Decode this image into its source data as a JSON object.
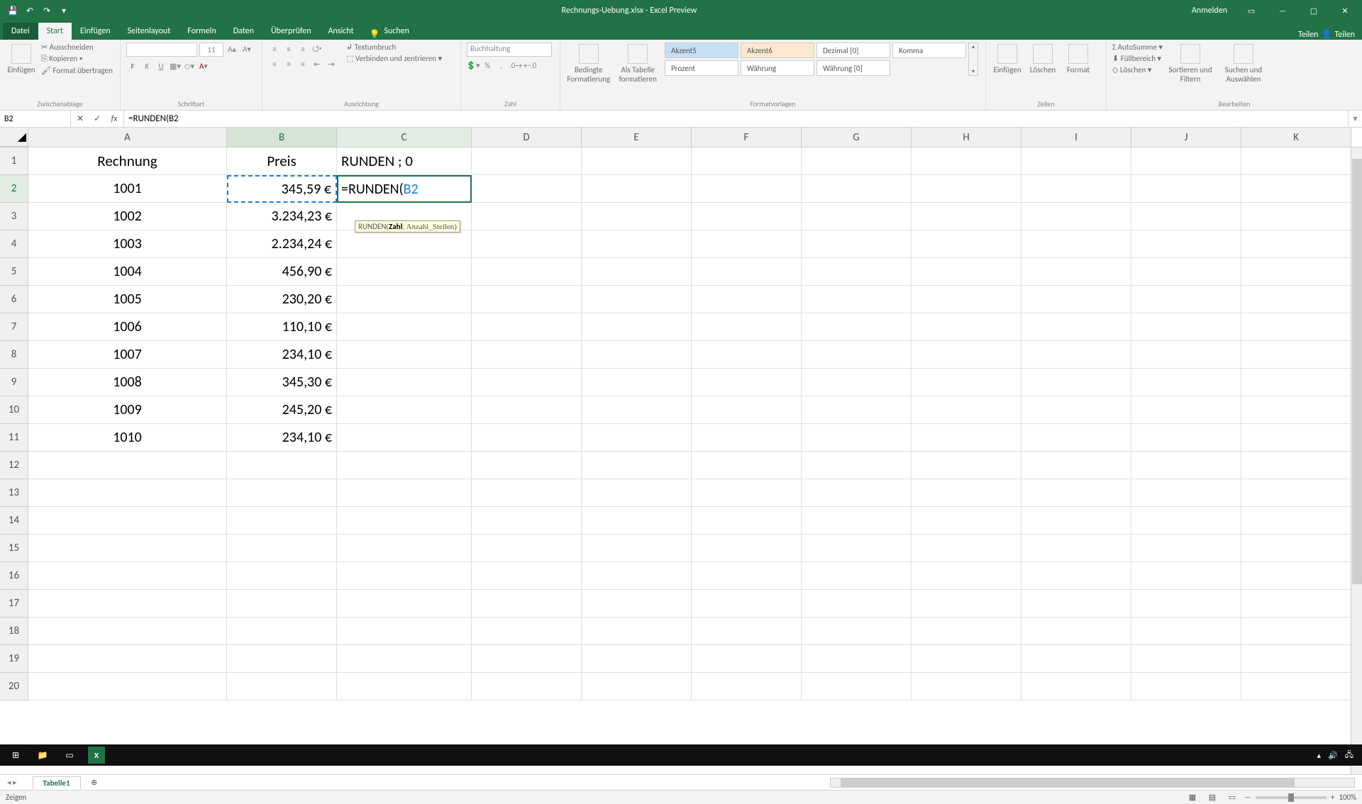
{
  "title_bar": {
    "document_title": "Rechnungs-Uebung.xlsx - Excel Preview",
    "sign_in_label": "Anmelden"
  },
  "ribbon": {
    "tabs": {
      "file": "Datei",
      "home": "Start",
      "insert": "Einfügen",
      "page_layout": "Seitenlayout",
      "formulas": "Formeln",
      "data": "Daten",
      "review": "Überprüfen",
      "view": "Ansicht",
      "search": "Suchen",
      "share": "Teilen"
    },
    "clipboard": {
      "paste": "Einfügen",
      "cut": "Ausschneiden",
      "copy": "Kopieren",
      "format_painter": "Format übertragen",
      "group_label": "Zwischenablage"
    },
    "font": {
      "size": "11",
      "group_label": "Schriftart"
    },
    "alignment": {
      "wrap": "Textumbruch",
      "merge": "Verbinden und zentrieren",
      "group_label": "Ausrichtung"
    },
    "number": {
      "format": "Buchhaltung",
      "group_label": "Zahl"
    },
    "styles": {
      "cond_fmt": "Bedingte Formatierung",
      "tbl_fmt": "Als Tabelle formatieren",
      "accent5": "Akzent5",
      "accent6": "Akzent6",
      "decimal0": "Dezimal [0]",
      "comma": "Komma",
      "percent": "Prozent",
      "currency": "Währung",
      "currency0": "Währung [0]",
      "group_label": "Formatvorlagen"
    },
    "cells": {
      "insert": "Einfügen",
      "delete": "Löschen",
      "format": "Format",
      "group_label": "Zellen"
    },
    "editing": {
      "autosum": "AutoSumme",
      "fill": "Füllbereich",
      "clear": "Löschen",
      "sort": "Sortieren und Filtern",
      "find": "Suchen und Auswählen",
      "group_label": "Bearbeiten"
    }
  },
  "formula_bar": {
    "name_box": "B2",
    "formula": "=RUNDEN(B2"
  },
  "columns": [
    "A",
    "B",
    "C",
    "D",
    "E",
    "F",
    "G",
    "H",
    "I",
    "J",
    "K"
  ],
  "grid": {
    "headers": {
      "A": "Rechnung",
      "B": "Preis",
      "C": "RUNDEN ; 0"
    },
    "rows": [
      {
        "n": 1,
        "A": "Rechnung",
        "B": "Preis",
        "C": "RUNDEN ; 0",
        "is_header": true
      },
      {
        "n": 2,
        "A": "1001",
        "B": "345,59 €",
        "C_formula_prefix": "=RUNDEN(",
        "C_formula_ref": "B2"
      },
      {
        "n": 3,
        "A": "1002",
        "B": "3.234,23 €"
      },
      {
        "n": 4,
        "A": "1003",
        "B": "2.234,24 €"
      },
      {
        "n": 5,
        "A": "1004",
        "B": "456,90 €"
      },
      {
        "n": 6,
        "A": "1005",
        "B": "230,20 €"
      },
      {
        "n": 7,
        "A": "1006",
        "B": "110,10 €"
      },
      {
        "n": 8,
        "A": "1007",
        "B": "234,10 €"
      },
      {
        "n": 9,
        "A": "1008",
        "B": "345,30 €"
      },
      {
        "n": 10,
        "A": "1009",
        "B": "245,20 €"
      },
      {
        "n": 11,
        "A": "1010",
        "B": "234,10 €"
      }
    ],
    "empty_rows_end": 20
  },
  "tooltip": {
    "fn_name": "RUNDEN",
    "args": "(Zahl; Anzahl_Stellen)",
    "bold_arg": "Zahl"
  },
  "sheet_bar": {
    "active_tab": "Tabelle1"
  },
  "status_bar": {
    "mode": "Zeigen",
    "zoom": "100%"
  }
}
